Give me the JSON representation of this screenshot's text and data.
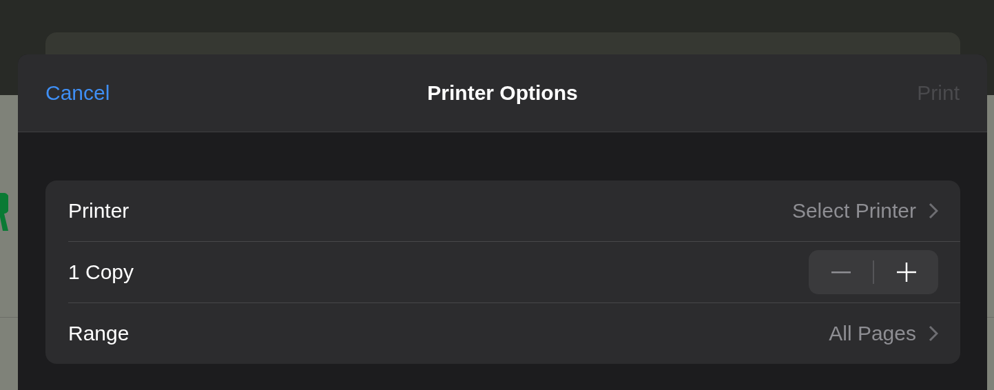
{
  "sheet": {
    "title": "Printer Options",
    "cancel_button": {
      "label": "Cancel"
    },
    "print_button": {
      "label": "Print",
      "disabled": true
    }
  },
  "options": [
    {
      "kind": "link",
      "label": "Printer",
      "value": "Select Printer"
    },
    {
      "kind": "stepper",
      "label": "1 Copy"
    },
    {
      "kind": "link",
      "label": "Range",
      "value": "All Pages"
    }
  ]
}
